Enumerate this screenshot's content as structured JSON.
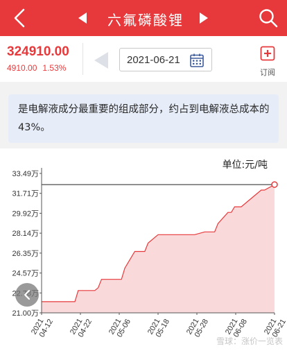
{
  "header": {
    "title": "六氟磷酸锂",
    "back_icon": "back-icon",
    "prev_icon": "prev-triangle-icon",
    "next_icon": "next-triangle-icon",
    "search_icon": "search-icon",
    "bg_color": "#e7393b"
  },
  "quote": {
    "price": "324910.00",
    "change_abs": "4910.00",
    "change_pct": "1.53%",
    "color": "#e7393b"
  },
  "date_picker": {
    "date": "2021-06-21",
    "calendar_icon": "calendar-icon",
    "prev_icon": "date-prev-icon"
  },
  "subscribe": {
    "label": "订阅",
    "icon": "plus-box-icon"
  },
  "description": {
    "text": "是电解液成分最重要的组成部分，约占到电解液总成本的43%。"
  },
  "chart_unit": "单位:元/吨",
  "watermark": "雪球：涨价一览表",
  "chart_data": {
    "type": "area",
    "x_ticks": [
      "2021\n04-12",
      "2021\n04-22",
      "2021\n05-06",
      "2021\n05-18",
      "2021\n05-28",
      "2021\n06-08",
      "2021\n06-21"
    ],
    "y_ticks": [
      "33.49万",
      "31.71万",
      "29.92万",
      "28.14万",
      "26.35万",
      "24.57万",
      "22.78万",
      "21.00万"
    ],
    "ylim": [
      210000,
      334900
    ],
    "series": [
      {
        "points": [
          [
            "2021-04-12",
            220000
          ],
          [
            "2021-04-22",
            220000
          ],
          [
            "2021-04-23",
            230000
          ],
          [
            "2021-04-28",
            230000
          ],
          [
            "2021-04-29",
            232500
          ],
          [
            "2021-04-30",
            240000
          ],
          [
            "2021-05-06",
            240000
          ],
          [
            "2021-05-07",
            250000
          ],
          [
            "2021-05-10",
            265000
          ],
          [
            "2021-05-13",
            265000
          ],
          [
            "2021-05-14",
            272500
          ],
          [
            "2021-05-17",
            280000
          ],
          [
            "2021-05-28",
            280000
          ],
          [
            "2021-05-31",
            282500
          ],
          [
            "2021-06-03",
            282500
          ],
          [
            "2021-06-04",
            290000
          ],
          [
            "2021-06-07",
            300000
          ],
          [
            "2021-06-08",
            300000
          ],
          [
            "2021-06-09",
            305000
          ],
          [
            "2021-06-11",
            305000
          ],
          [
            "2021-06-15",
            315000
          ],
          [
            "2021-06-17",
            320000
          ],
          [
            "2021-06-18",
            320000
          ],
          [
            "2021-06-21",
            324910
          ]
        ],
        "color": "#e7393b",
        "fill": "#f9d9da"
      }
    ],
    "reference_line": 324910,
    "grid": false,
    "legend": "none"
  }
}
